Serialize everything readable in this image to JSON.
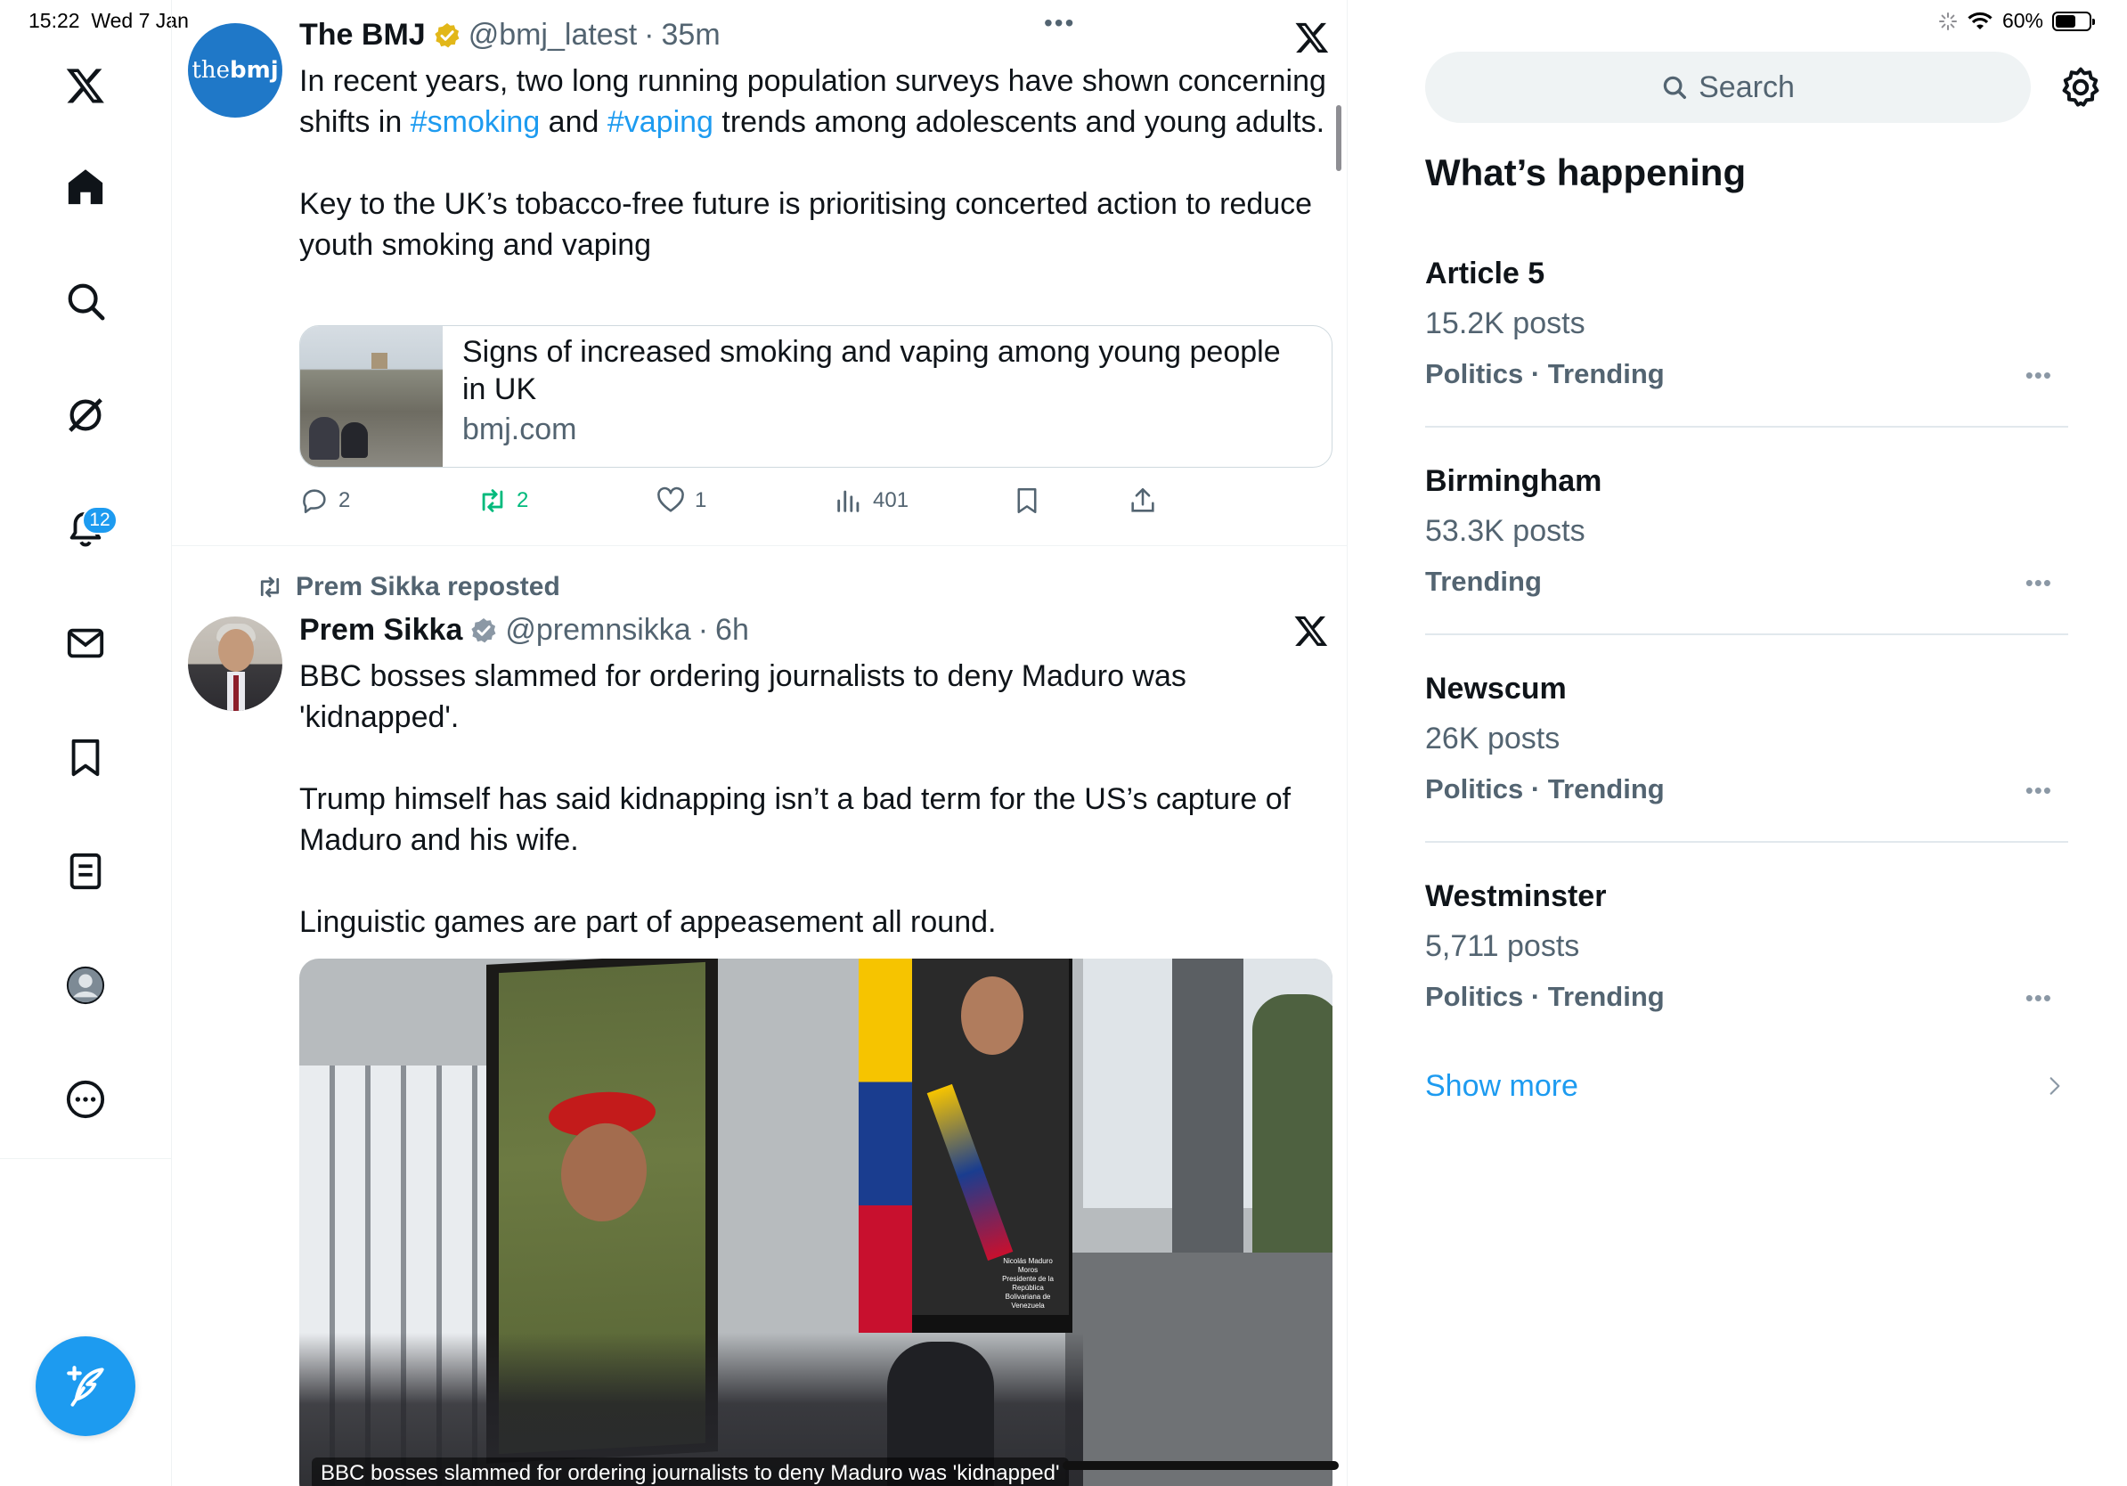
{
  "status_bar": {
    "time": "15:22",
    "date": "Wed 7 Jan",
    "battery": "60%",
    "battery_level": 0.6
  },
  "nav": {
    "notifications_badge": "12",
    "accent": "#1d9bf0",
    "icons": [
      "x-logo-icon",
      "home-icon",
      "search-icon",
      "grok-icon",
      "bell-icon",
      "mail-icon",
      "bookmark-icon",
      "article-icon",
      "profile-icon",
      "more-icon",
      "compose-icon"
    ]
  },
  "tweet1": {
    "avatar_text_thin": "the",
    "avatar_text_bold": "bmj",
    "name": "The BMJ",
    "handle": "@bmj_latest",
    "time": "35m",
    "text_part1": "In recent years, two long running population surveys have shown concerning shifts in ",
    "hashtag1": "#smoking",
    "text_part2": " and ",
    "hashtag2": "#vaping",
    "text_part3": " trends among adolescents and young adults.\n\nKey to the UK’s tobacco-free future is prioritising concerted action to reduce youth smoking and vaping",
    "card_title": "Signs of increased smoking and vaping among young people in UK",
    "card_domain": "bmj.com",
    "replies": "2",
    "reposts": "2",
    "likes": "1",
    "views": "401"
  },
  "tweet2": {
    "repost_label": "Prem Sikka reposted",
    "name": "Prem Sikka",
    "handle": "@premnsikka",
    "time": "6h",
    "text": "BBC bosses slammed for ordering journalists to deny Maduro was 'kidnapped'.\n\nTrump himself has said kidnapping isn’t a bad term for the US’s capture of Maduro and his wife.\n\nLinguistic games are part of appeasement all round.",
    "media_caption": "BBC bosses slammed for ordering journalists to deny Maduro was 'kidnapped'",
    "poster_caption": "Nicolás Maduro Moros\nPresidente de la República\nBolivariana de Venezuela"
  },
  "right": {
    "search_placeholder": "Search",
    "section_title": "What’s happening",
    "trends": [
      {
        "name": "Article 5",
        "posts": "15.2K posts",
        "category": "Politics · Trending"
      },
      {
        "name": "Birmingham",
        "posts": "53.3K posts",
        "category": "Trending"
      },
      {
        "name": "Newscum",
        "posts": "26K posts",
        "category": "Politics · Trending"
      },
      {
        "name": "Westminster",
        "posts": "5,711 posts",
        "category": "Politics · Trending"
      }
    ],
    "show_more": "Show more"
  }
}
